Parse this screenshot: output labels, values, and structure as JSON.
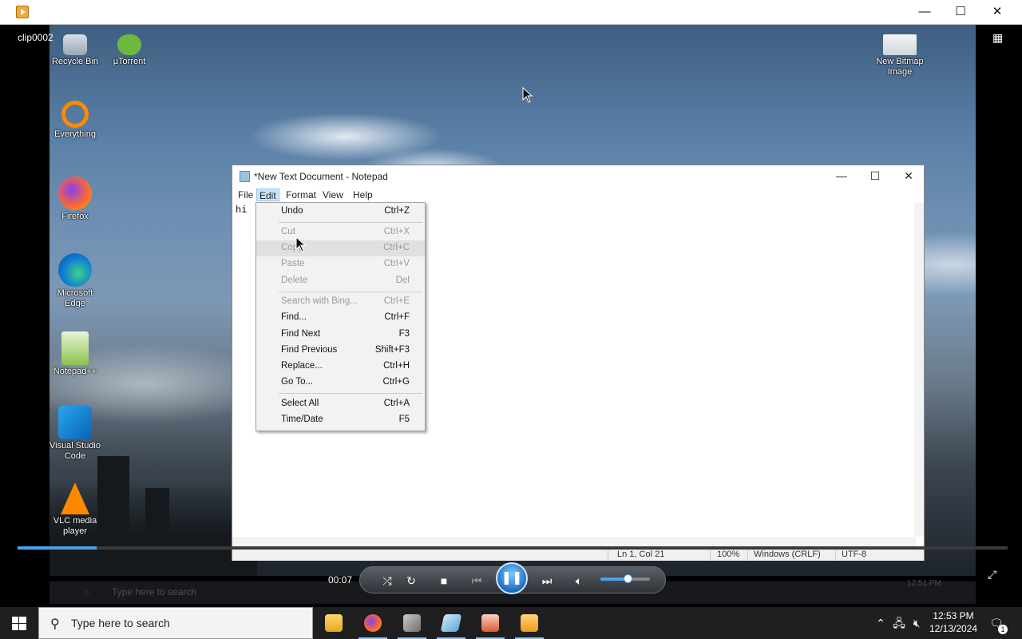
{
  "player": {
    "clip_name": "clip0002",
    "minimize": "—",
    "maximize": "☐",
    "close": "✕",
    "elapsed": "00:07",
    "progress": 0.08,
    "volume": 0.55
  },
  "desktop_icons": [
    {
      "label": "Recycle Bin",
      "icon": "recycle-bin-icon"
    },
    {
      "label": "µTorrent",
      "icon": "utorrent-icon"
    },
    {
      "label": "New Bitmap Image",
      "icon": "bitmap-image-icon"
    },
    {
      "label": "Everything",
      "icon": "everything-search-icon"
    },
    {
      "label": "Firefox",
      "icon": "firefox-icon"
    },
    {
      "label": "Microsoft Edge",
      "icon": "edge-icon"
    },
    {
      "label": "Notepad++",
      "icon": "notepadpp-icon"
    },
    {
      "label": "Visual Studio Code",
      "icon": "vscode-icon"
    },
    {
      "label": "VLC media player",
      "icon": "vlc-icon"
    }
  ],
  "notepad": {
    "title": "*New Text Document - Notepad",
    "menu": [
      "File",
      "Edit",
      "Format",
      "View",
      "Help"
    ],
    "content": "hi",
    "status": {
      "position": "Ln 1, Col 21",
      "zoom": "100%",
      "line_ending": "Windows (CRLF)",
      "encoding": "UTF-8"
    }
  },
  "edit_menu": [
    {
      "label": "Undo",
      "key": "Ctrl+Z",
      "enabled": true
    },
    {
      "label": "Cut",
      "key": "Ctrl+X",
      "enabled": false
    },
    {
      "label": "Copy",
      "key": "Ctrl+C",
      "enabled": false
    },
    {
      "label": "Paste",
      "key": "Ctrl+V",
      "enabled": false
    },
    {
      "label": "Delete",
      "key": "Del",
      "enabled": false
    },
    {
      "label": "Search with Bing...",
      "key": "Ctrl+E",
      "enabled": false
    },
    {
      "label": "Find...",
      "key": "Ctrl+F",
      "enabled": true
    },
    {
      "label": "Find Next",
      "key": "F3",
      "enabled": true
    },
    {
      "label": "Find Previous",
      "key": "Shift+F3",
      "enabled": true
    },
    {
      "label": "Replace...",
      "key": "Ctrl+H",
      "enabled": true
    },
    {
      "label": "Go To...",
      "key": "Ctrl+G",
      "enabled": true
    },
    {
      "label": "Select All",
      "key": "Ctrl+A",
      "enabled": true
    },
    {
      "label": "Time/Date",
      "key": "F5",
      "enabled": true
    }
  ],
  "video_taskbar": {
    "search_placeholder": "Type here to search",
    "time": "12:51 PM"
  },
  "taskbar": {
    "search_placeholder": "Type here to search",
    "time": "12:53 PM",
    "date": "12/13/2024",
    "notification_count": "1"
  },
  "colors": {
    "accent": "#4aa3e8",
    "taskbar": "#1f1f1f"
  }
}
